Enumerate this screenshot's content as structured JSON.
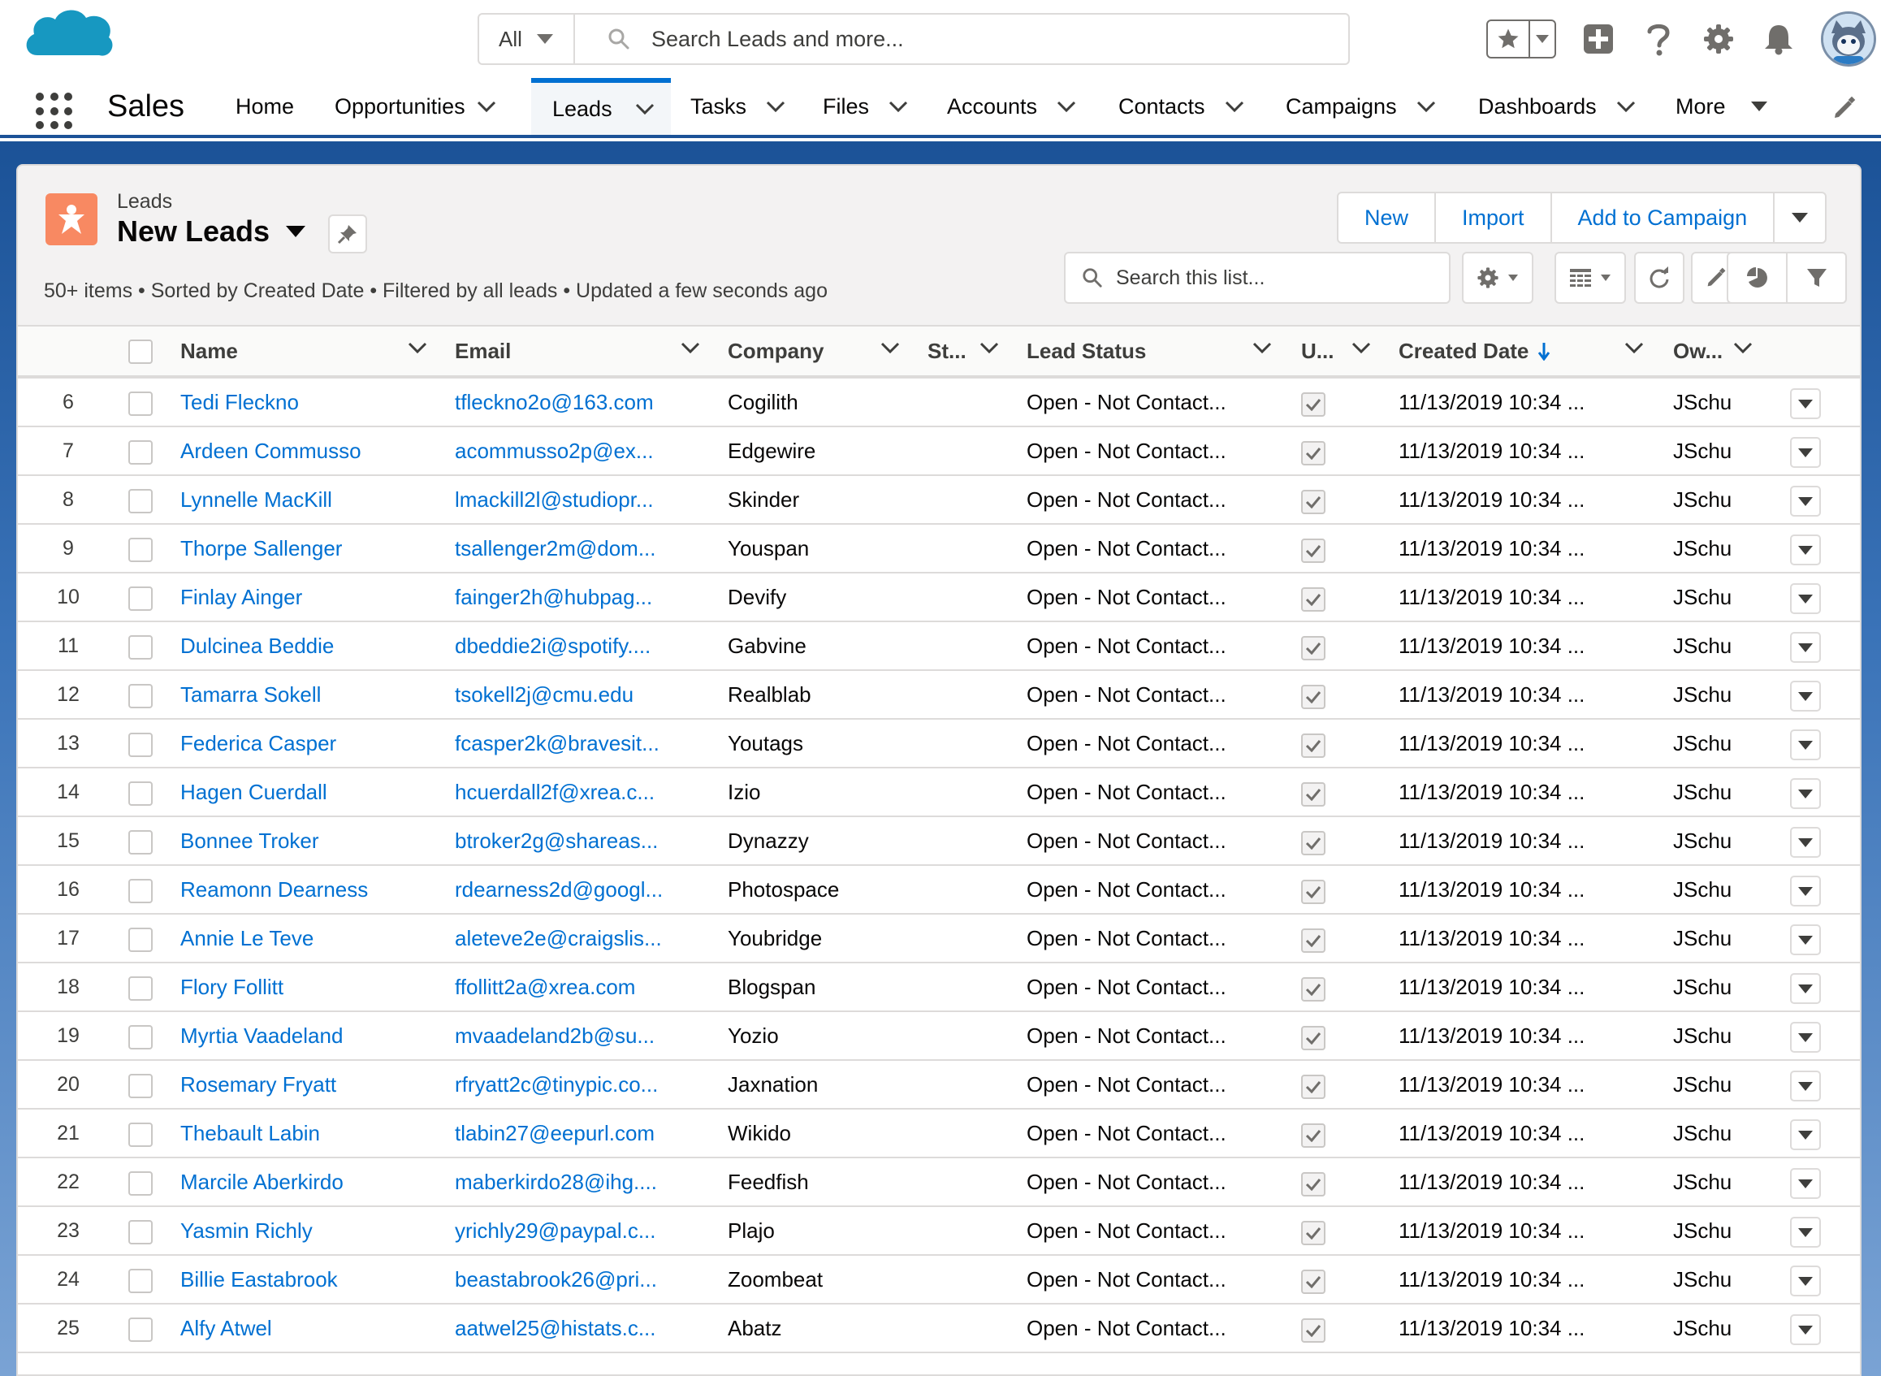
{
  "global_header": {
    "search_scope": "All",
    "search_placeholder": "Search Leads and more..."
  },
  "app_nav": {
    "app_name": "Sales",
    "tabs": [
      {
        "label": "Home",
        "has_menu": false,
        "active": false
      },
      {
        "label": "Opportunities",
        "has_menu": true,
        "active": false
      },
      {
        "label": "Leads",
        "has_menu": true,
        "active": true
      },
      {
        "label": "Tasks",
        "has_menu": true,
        "active": false
      },
      {
        "label": "Files",
        "has_menu": true,
        "active": false
      },
      {
        "label": "Accounts",
        "has_menu": true,
        "active": false
      },
      {
        "label": "Contacts",
        "has_menu": true,
        "active": false
      },
      {
        "label": "Campaigns",
        "has_menu": true,
        "active": false
      },
      {
        "label": "Dashboards",
        "has_menu": true,
        "active": false
      },
      {
        "label": "More",
        "has_menu": true,
        "active": false
      }
    ]
  },
  "list_view": {
    "object_label": "Leads",
    "title": "New Leads",
    "meta": "50+ items • Sorted by Created Date • Filtered by all leads • Updated a few seconds ago",
    "actions": [
      "New",
      "Import",
      "Add to Campaign"
    ],
    "search_placeholder": "Search this list...",
    "columns": [
      "Name",
      "Email",
      "Company",
      "St...",
      "Lead Status",
      "U...",
      "Created Date",
      "Ow..."
    ],
    "sorted_column": "Created Date",
    "rows": [
      {
        "num": "6",
        "name": "Tedi Fleckno",
        "email": "tfleckno2o@163.com",
        "company": "Cogilith",
        "status": "Open - Not Contact...",
        "created": "11/13/2019 10:34 ...",
        "owner": "JSchu"
      },
      {
        "num": "7",
        "name": "Ardeen Commusso",
        "email": "acommusso2p@ex...",
        "company": "Edgewire",
        "status": "Open - Not Contact...",
        "created": "11/13/2019 10:34 ...",
        "owner": "JSchu"
      },
      {
        "num": "8",
        "name": "Lynnelle MacKill",
        "email": "lmackill2l@studiopr...",
        "company": "Skinder",
        "status": "Open - Not Contact...",
        "created": "11/13/2019 10:34 ...",
        "owner": "JSchu"
      },
      {
        "num": "9",
        "name": "Thorpe Sallenger",
        "email": "tsallenger2m@dom...",
        "company": "Youspan",
        "status": "Open - Not Contact...",
        "created": "11/13/2019 10:34 ...",
        "owner": "JSchu"
      },
      {
        "num": "10",
        "name": "Finlay Ainger",
        "email": "fainger2h@hubpag...",
        "company": "Devify",
        "status": "Open - Not Contact...",
        "created": "11/13/2019 10:34 ...",
        "owner": "JSchu"
      },
      {
        "num": "11",
        "name": "Dulcinea Beddie",
        "email": "dbeddie2i@spotify....",
        "company": "Gabvine",
        "status": "Open - Not Contact...",
        "created": "11/13/2019 10:34 ...",
        "owner": "JSchu"
      },
      {
        "num": "12",
        "name": "Tamarra Sokell",
        "email": "tsokell2j@cmu.edu",
        "company": "Realblab",
        "status": "Open - Not Contact...",
        "created": "11/13/2019 10:34 ...",
        "owner": "JSchu"
      },
      {
        "num": "13",
        "name": "Federica Casper",
        "email": "fcasper2k@bravesit...",
        "company": "Youtags",
        "status": "Open - Not Contact...",
        "created": "11/13/2019 10:34 ...",
        "owner": "JSchu"
      },
      {
        "num": "14",
        "name": "Hagen Cuerdall",
        "email": "hcuerdall2f@xrea.c...",
        "company": "Izio",
        "status": "Open - Not Contact...",
        "created": "11/13/2019 10:34 ...",
        "owner": "JSchu"
      },
      {
        "num": "15",
        "name": "Bonnee Troker",
        "email": "btroker2g@shareas...",
        "company": "Dynazzy",
        "status": "Open - Not Contact...",
        "created": "11/13/2019 10:34 ...",
        "owner": "JSchu"
      },
      {
        "num": "16",
        "name": "Reamonn Dearness",
        "email": "rdearness2d@googl...",
        "company": "Photospace",
        "status": "Open - Not Contact...",
        "created": "11/13/2019 10:34 ...",
        "owner": "JSchu"
      },
      {
        "num": "17",
        "name": "Annie Le Teve",
        "email": "aleteve2e@craigslis...",
        "company": "Youbridge",
        "status": "Open - Not Contact...",
        "created": "11/13/2019 10:34 ...",
        "owner": "JSchu"
      },
      {
        "num": "18",
        "name": "Flory Follitt",
        "email": "ffollitt2a@xrea.com",
        "company": "Blogspan",
        "status": "Open - Not Contact...",
        "created": "11/13/2019 10:34 ...",
        "owner": "JSchu"
      },
      {
        "num": "19",
        "name": "Myrtia Vaadeland",
        "email": "mvaadeland2b@su...",
        "company": "Yozio",
        "status": "Open - Not Contact...",
        "created": "11/13/2019 10:34 ...",
        "owner": "JSchu"
      },
      {
        "num": "20",
        "name": "Rosemary Fryatt",
        "email": "rfryatt2c@tinypic.co...",
        "company": "Jaxnation",
        "status": "Open - Not Contact...",
        "created": "11/13/2019 10:34 ...",
        "owner": "JSchu"
      },
      {
        "num": "21",
        "name": "Thebault Labin",
        "email": "tlabin27@eepurl.com",
        "company": "Wikido",
        "status": "Open - Not Contact...",
        "created": "11/13/2019 10:34 ...",
        "owner": "JSchu"
      },
      {
        "num": "22",
        "name": "Marcile Aberkirdo",
        "email": "maberkirdo28@ihg....",
        "company": "Feedfish",
        "status": "Open - Not Contact...",
        "created": "11/13/2019 10:34 ...",
        "owner": "JSchu"
      },
      {
        "num": "23",
        "name": "Yasmin Richly",
        "email": "yrichly29@paypal.c...",
        "company": "Plajo",
        "status": "Open - Not Contact...",
        "created": "11/13/2019 10:34 ...",
        "owner": "JSchu"
      },
      {
        "num": "24",
        "name": "Billie Eastabrook",
        "email": "beastabrook26@pri...",
        "company": "Zoombeat",
        "status": "Open - Not Contact...",
        "created": "11/13/2019 10:34 ...",
        "owner": "JSchu"
      },
      {
        "num": "25",
        "name": "Alfy Atwel",
        "email": "aatwel25@histats.c...",
        "company": "Abatz",
        "status": "Open - Not Contact...",
        "created": "11/13/2019 10:34 ...",
        "owner": "JSchu"
      }
    ]
  },
  "colors": {
    "brand_blue": "#0070d2",
    "nav_band": "#1b5297",
    "lead_icon": "#f88962",
    "cloud_logo": "#1798c1"
  },
  "icons": [
    "salesforce-cloud-logo",
    "search-icon",
    "star-icon",
    "add-icon",
    "help-icon",
    "gear-icon",
    "bell-icon",
    "app-launcher-icon",
    "pencil-icon",
    "pin-icon",
    "table-icon",
    "refresh-icon",
    "chart-icon",
    "filter-icon",
    "lead-icon",
    "checkmark-icon",
    "arrow-down-icon"
  ]
}
